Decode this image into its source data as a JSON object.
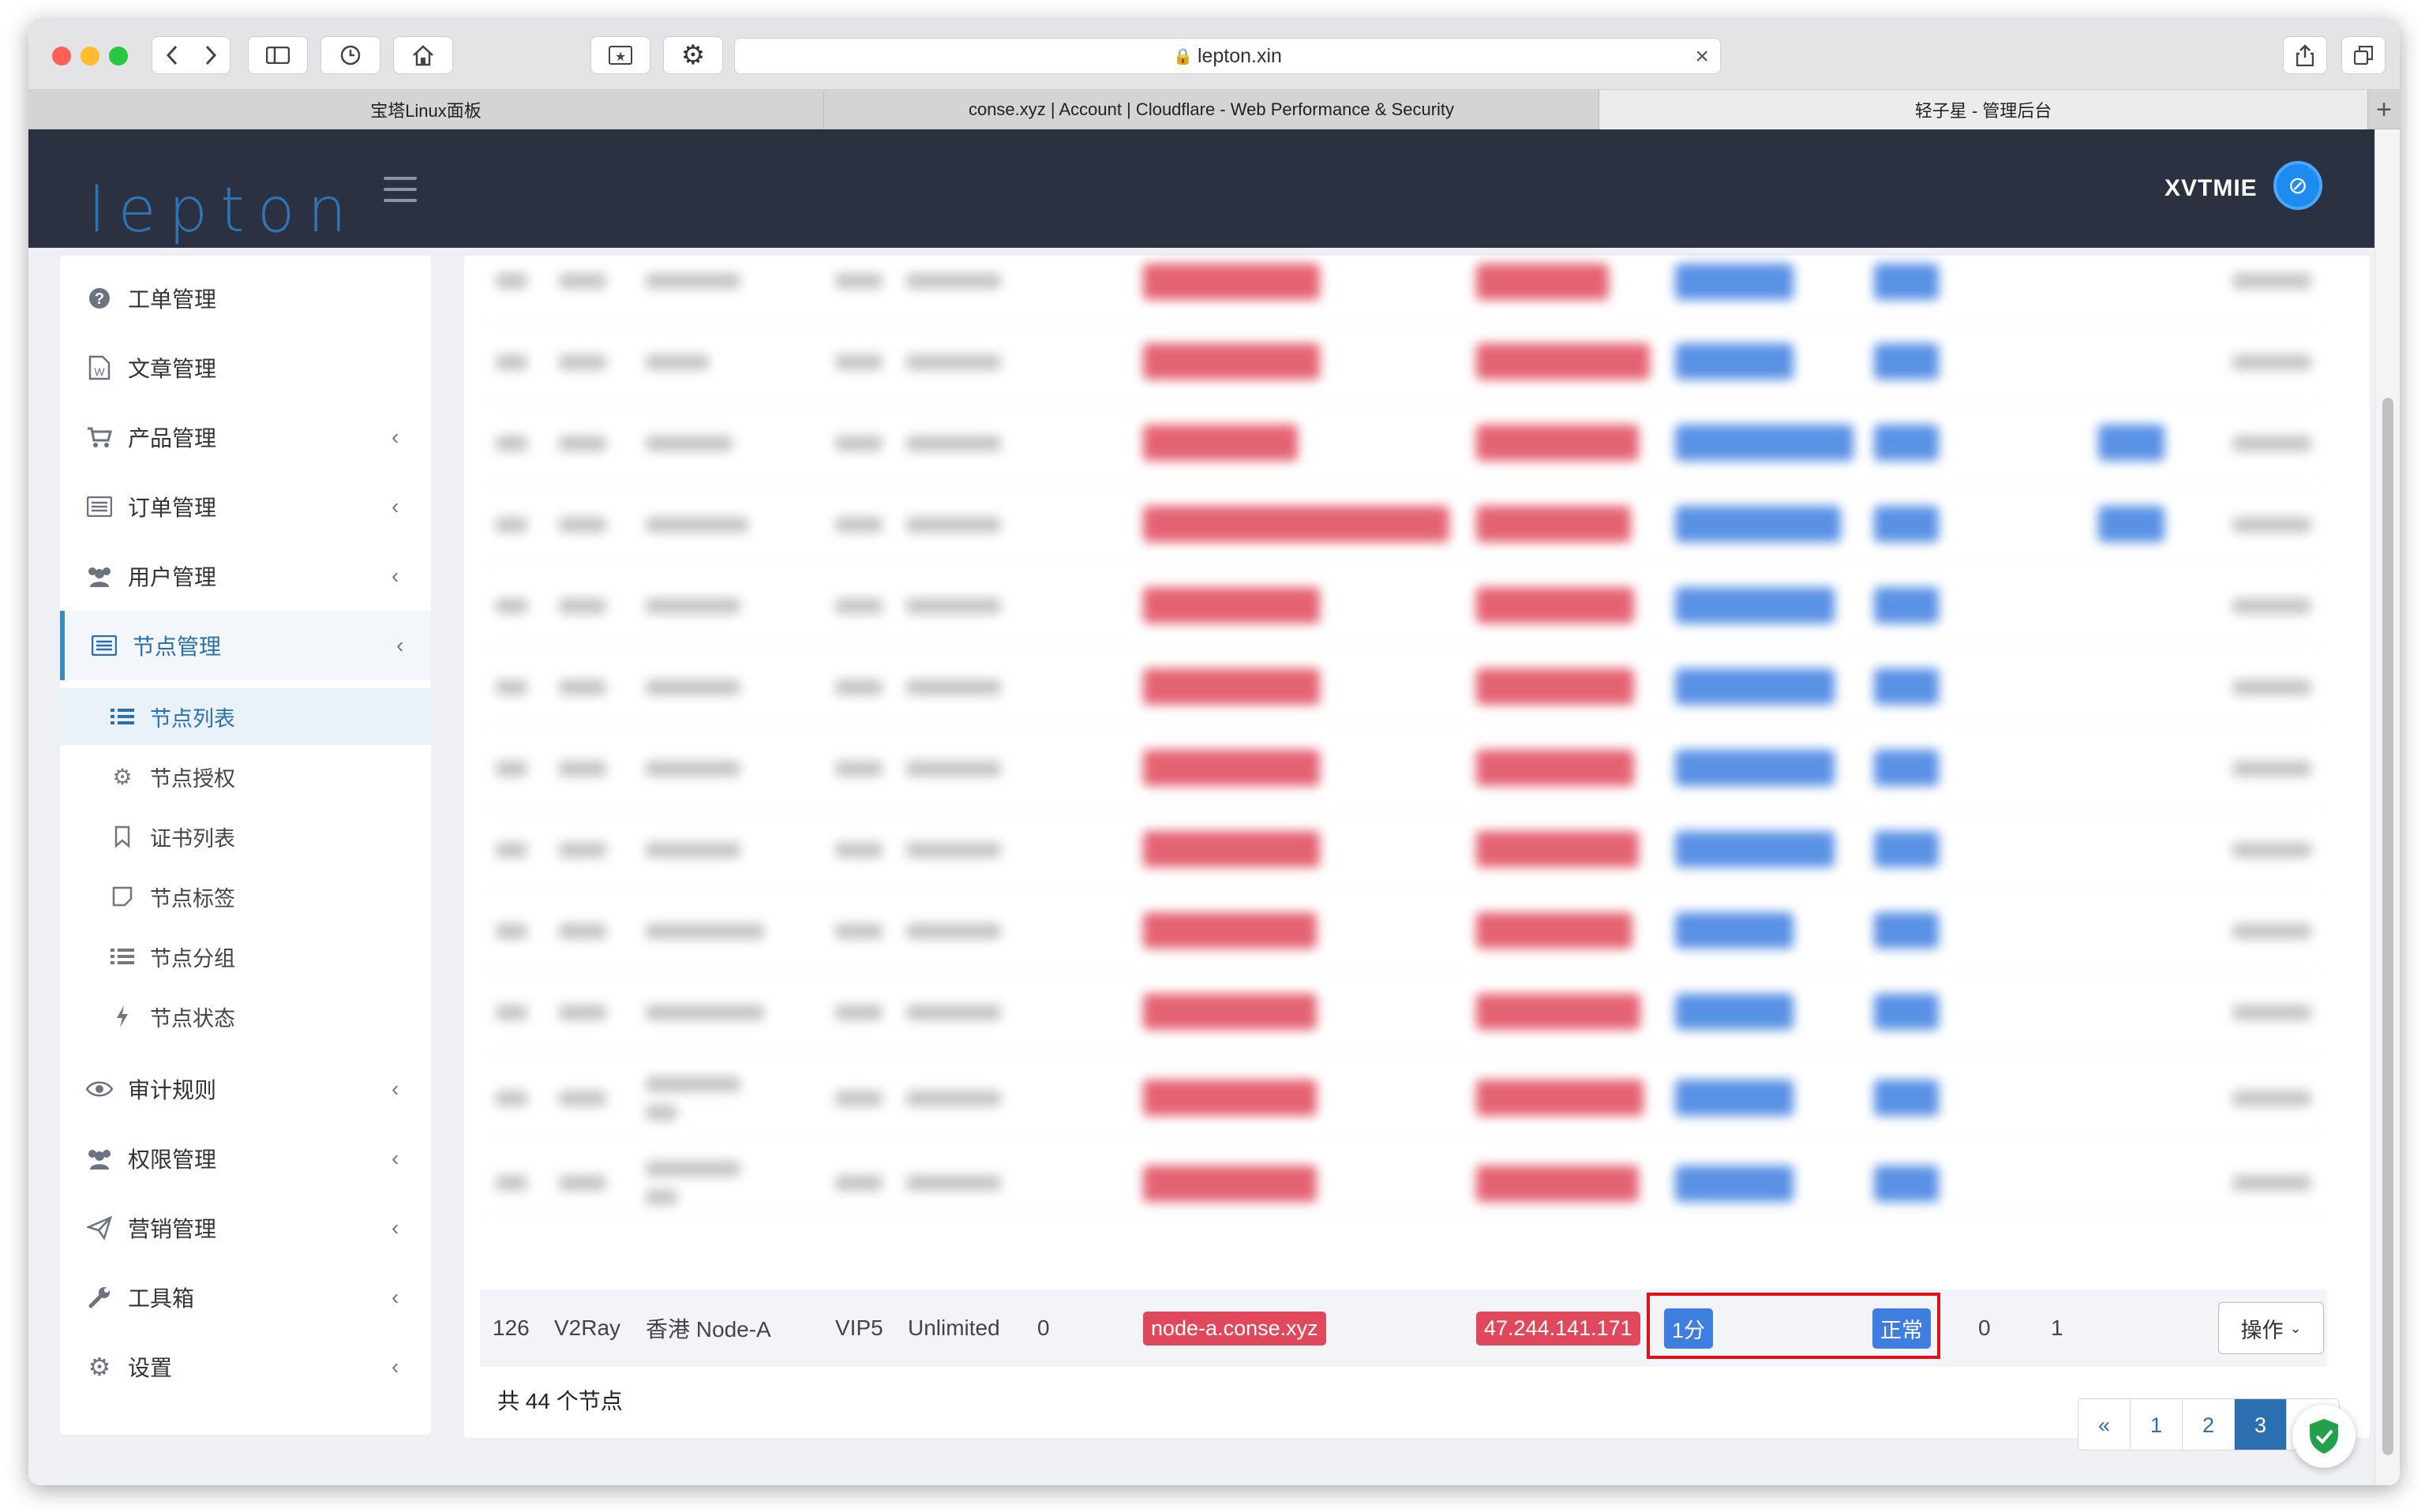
{
  "browser": {
    "url": "lepton.xin",
    "tabs": [
      {
        "title": "宝塔Linux面板"
      },
      {
        "title": "conse.xyz | Account | Cloudflare - Web Performance & Security"
      },
      {
        "title": "轻子星 - 管理后台"
      }
    ]
  },
  "header": {
    "logo": "lepton",
    "username": "XVTMIE"
  },
  "sidebar": {
    "items": [
      {
        "label": "工单管理"
      },
      {
        "label": "文章管理"
      },
      {
        "label": "产品管理"
      },
      {
        "label": "订单管理"
      },
      {
        "label": "用户管理"
      },
      {
        "label": "节点管理"
      },
      {
        "label": "审计规则"
      },
      {
        "label": "权限管理"
      },
      {
        "label": "营销管理"
      },
      {
        "label": "工具箱"
      },
      {
        "label": "设置"
      }
    ],
    "sub_items": [
      {
        "label": "节点列表"
      },
      {
        "label": "节点授权"
      },
      {
        "label": "证书列表"
      },
      {
        "label": "节点标签"
      },
      {
        "label": "节点分组"
      },
      {
        "label": "节点状态"
      }
    ]
  },
  "table": {
    "visible_row": {
      "id": "126",
      "type": "V2Ray",
      "name": "香港 Node-A",
      "level": "VIP5",
      "bandwidth": "Unlimited",
      "col0": "0",
      "domain": "node-a.conse.xyz",
      "ip": "47.244.141.171",
      "interval": "1分",
      "status": "正常",
      "count_a": "0",
      "count_b": "1",
      "action": "操作"
    }
  },
  "footer": {
    "total": "共 44 个节点"
  },
  "pagination": {
    "prev": "«",
    "pages": [
      "1",
      "2",
      "3"
    ],
    "next": "»",
    "current": "3"
  }
}
